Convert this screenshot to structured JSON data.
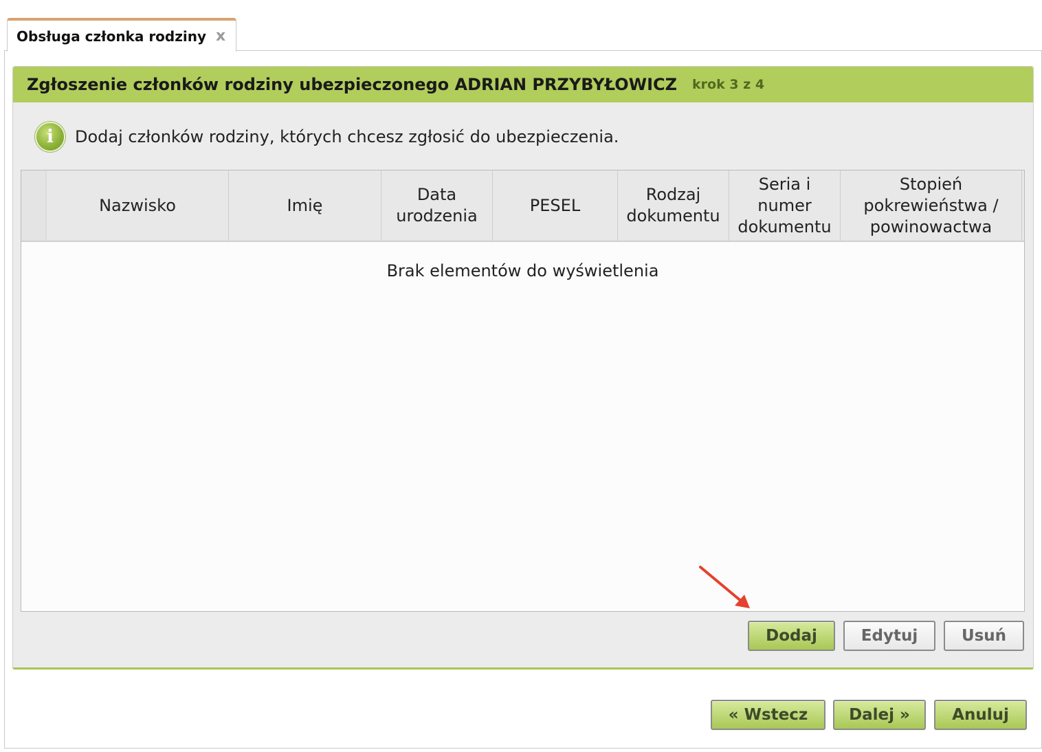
{
  "tab": {
    "label": "Obsługa członka rodziny",
    "close_glyph": "x"
  },
  "panel": {
    "title": "Zgłoszenie członków rodziny ubezpieczonego ADRIAN PRZYBYŁOWICZ",
    "step": "krok 3 z 4",
    "info_icon_glyph": "i",
    "info_text": "Dodaj członków rodziny, których chcesz zgłosić do ubezpieczenia."
  },
  "grid": {
    "columns": [
      "Nazwisko",
      "Imię",
      "Data\nurodzenia",
      "PESEL",
      "Rodzaj\ndokumentu",
      "Seria i\nnumer\ndokumentu",
      "Stopień\npokrewieństwa /\npowinowactwa"
    ],
    "empty_text": "Brak elementów do wyświetlenia"
  },
  "grid_buttons": {
    "add": "Dodaj",
    "edit": "Edytuj",
    "delete": "Usuń"
  },
  "footer_buttons": {
    "back": "« Wstecz",
    "next": "Dalej »",
    "cancel": "Anuluj"
  },
  "colors": {
    "header_green": "#b1cd5c",
    "tab_accent": "#d9a26f",
    "arrow_red": "#e5412d"
  },
  "icons": [
    "close-icon",
    "info-icon",
    "annotation-arrow-icon"
  ]
}
